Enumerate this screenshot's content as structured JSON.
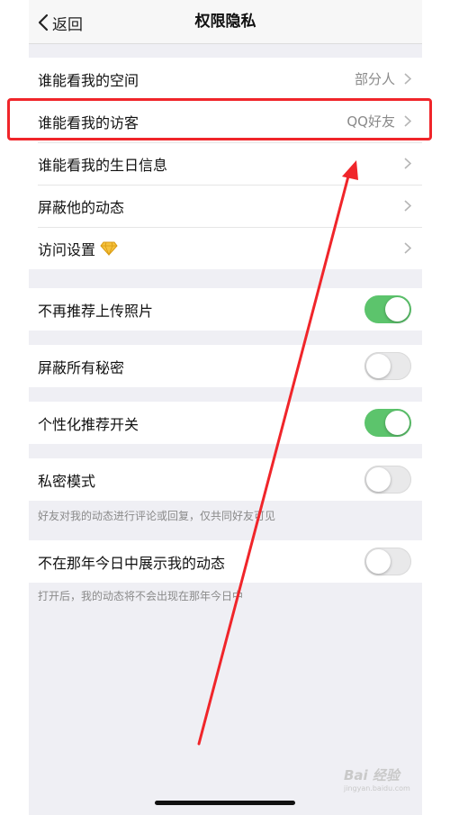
{
  "navbar": {
    "back_label": "返回",
    "title": "权限隐私"
  },
  "privacy_group": [
    {
      "label": "谁能看我的空间",
      "value": "部分人"
    },
    {
      "label": "谁能看我的访客",
      "value": "QQ好友"
    },
    {
      "label": "谁能看我的生日信息",
      "value": ""
    },
    {
      "label": "屏蔽他的动态",
      "value": ""
    },
    {
      "label": "访问设置",
      "value": ""
    }
  ],
  "toggles": {
    "recommend_photos": {
      "label": "不再推荐上传照片",
      "on": true
    },
    "block_secrets": {
      "label": "屏蔽所有秘密",
      "on": false
    },
    "personalized": {
      "label": "个性化推荐开关",
      "on": true
    },
    "private_mode": {
      "label": "私密模式",
      "on": false,
      "note": "好友对我的动态进行评论或回复，仅共同好友可见"
    },
    "on_this_day": {
      "label": "不在那年今日中展示我的动态",
      "on": false,
      "note": "打开后，我的动态将不会出现在那年今日中"
    }
  },
  "watermark": {
    "main": "Bai 经验",
    "sub": "jingyan.baidu.com"
  },
  "colors": {
    "toggle_on": "#5cc46c",
    "highlight": "#f0252a",
    "diamond": "#f5c13a"
  },
  "icons": [
    "chevron-left-icon",
    "chevron-right-icon",
    "diamond-icon"
  ]
}
